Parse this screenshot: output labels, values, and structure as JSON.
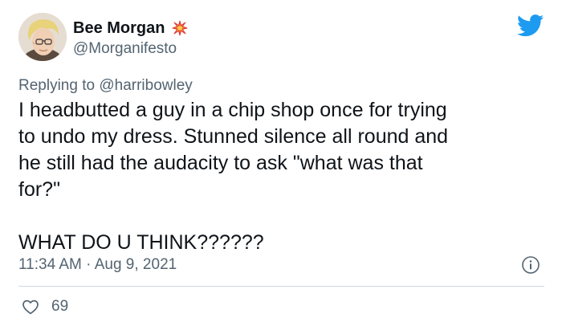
{
  "author": {
    "display_name": "Bee Morgan",
    "handle": "@Morganifesto",
    "name_emoji": "collision-emoji"
  },
  "reply": {
    "prefix": "Replying to ",
    "handle": "@harribowley"
  },
  "tweet": {
    "body": "I headbutted a guy in a chip shop once for trying\nto undo my dress. Stunned silence all round and\nhe still had the audacity to ask \"what was that\nfor?\"\n\nWHAT DO U THINK??????",
    "time": "11:34 AM",
    "separator": " · ",
    "date": "Aug 9, 2021"
  },
  "engagement": {
    "likes": "69"
  },
  "colors": {
    "twitter_blue": "#1d9bf0",
    "secondary_text": "#536471",
    "primary_text": "#0f1419",
    "divider": "#cfd9de"
  },
  "icons": {
    "brand": "twitter-bird-icon",
    "info": "info-icon",
    "like": "heart-icon"
  }
}
